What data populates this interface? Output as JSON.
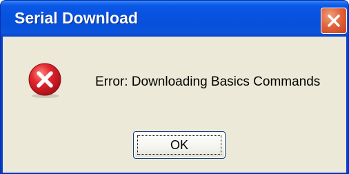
{
  "window": {
    "title": "Serial Download"
  },
  "dialog": {
    "icon": "error-icon",
    "message": "Error: Downloading Basics Commands",
    "ok_label": "OK"
  },
  "colors": {
    "titlebar": "#0852e0",
    "close_button": "#e2653c",
    "client_background": "#ece9d8",
    "error_icon": "#d0202a"
  }
}
